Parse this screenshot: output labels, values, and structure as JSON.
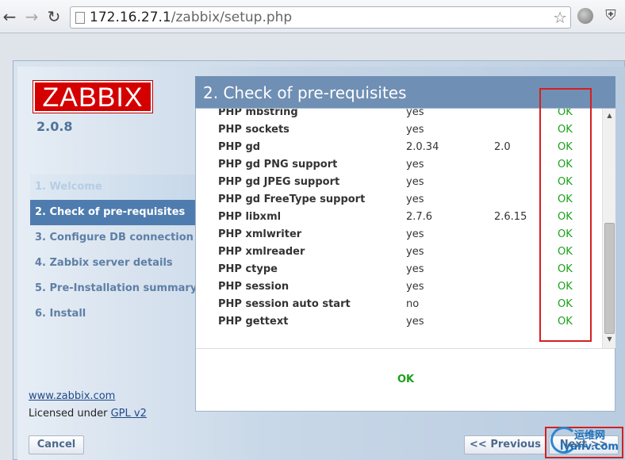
{
  "browser": {
    "url_host": "172.16.27.1",
    "url_path": "/zabbix/setup.php"
  },
  "sidebar": {
    "logo_text": "ZABBIX",
    "version": "2.0.8",
    "steps": [
      {
        "label": "1. Welcome",
        "state": "done"
      },
      {
        "label": "2. Check of pre-requisites",
        "state": "active"
      },
      {
        "label": "3. Configure DB connection",
        "state": "pending"
      },
      {
        "label": "4. Zabbix server details",
        "state": "pending"
      },
      {
        "label": "5. Pre-Installation summary",
        "state": "pending"
      },
      {
        "label": "6. Install",
        "state": "pending"
      }
    ],
    "site_link": "www.zabbix.com",
    "license_prefix": "Licensed under ",
    "license_link": "GPL v2"
  },
  "panel": {
    "title": "2. Check of pre-requisites",
    "requirements": [
      {
        "name": "PHP mbstring",
        "current": "yes",
        "required": "",
        "result": "OK"
      },
      {
        "name": "PHP sockets",
        "current": "yes",
        "required": "",
        "result": "OK"
      },
      {
        "name": "PHP gd",
        "current": "2.0.34",
        "required": "2.0",
        "result": "OK"
      },
      {
        "name": "PHP gd PNG support",
        "current": "yes",
        "required": "",
        "result": "OK"
      },
      {
        "name": "PHP gd JPEG support",
        "current": "yes",
        "required": "",
        "result": "OK"
      },
      {
        "name": "PHP gd FreeType support",
        "current": "yes",
        "required": "",
        "result": "OK"
      },
      {
        "name": "PHP libxml",
        "current": "2.7.6",
        "required": "2.6.15",
        "result": "OK"
      },
      {
        "name": "PHP xmlwriter",
        "current": "yes",
        "required": "",
        "result": "OK"
      },
      {
        "name": "PHP xmlreader",
        "current": "yes",
        "required": "",
        "result": "OK"
      },
      {
        "name": "PHP ctype",
        "current": "yes",
        "required": "",
        "result": "OK"
      },
      {
        "name": "PHP session",
        "current": "yes",
        "required": "",
        "result": "OK"
      },
      {
        "name": "PHP session auto start",
        "current": "no",
        "required": "",
        "result": "OK"
      },
      {
        "name": "PHP gettext",
        "current": "yes",
        "required": "",
        "result": "OK"
      }
    ],
    "overall_result": "OK"
  },
  "buttons": {
    "cancel": "Cancel",
    "previous": "<< Previous",
    "next": "Next >>"
  },
  "watermark": {
    "cn": "运维网",
    "en": "iyunv.com"
  },
  "colors": {
    "ok_green": "#1aa01a",
    "highlight_red": "#d42020",
    "accent_blue": "#4f7cae"
  }
}
